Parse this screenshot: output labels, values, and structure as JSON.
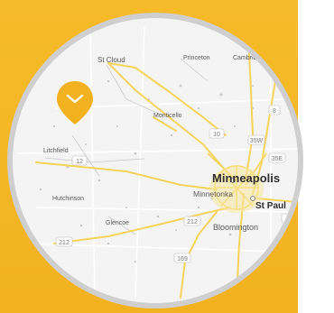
{
  "colors": {
    "background": "#f4b827",
    "circle_border": "#c9c9c9",
    "map_land": "#f3f3f3",
    "road_major": "#f7d45a",
    "road_minor": "#ffffff",
    "marker": "#f2b220"
  },
  "map": {
    "cities": [
      {
        "name": "St Cloud"
      },
      {
        "name": "Princeton"
      },
      {
        "name": "Cambridge"
      },
      {
        "name": "Monticello"
      },
      {
        "name": "Litchfield"
      },
      {
        "name": "Minneapolis"
      },
      {
        "name": "Minnetonka"
      },
      {
        "name": "St Paul"
      },
      {
        "name": "Hutchinson"
      },
      {
        "name": "Glencoe"
      },
      {
        "name": "Bloomington"
      }
    ],
    "route_shields": [
      "10",
      "12",
      "35W",
      "8",
      "212",
      "212",
      "169",
      "10",
      "35E"
    ]
  },
  "marker": {
    "icon": "location-pin-icon"
  }
}
